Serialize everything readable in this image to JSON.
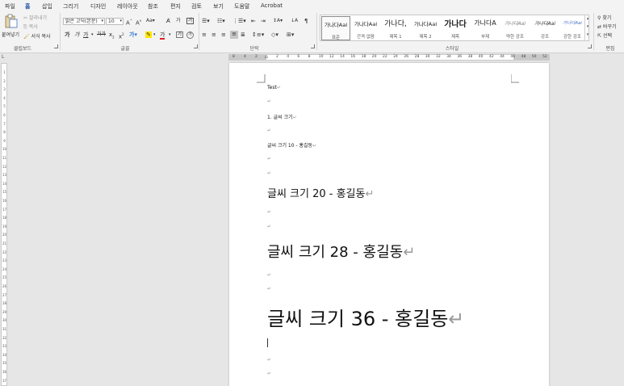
{
  "menu": {
    "items": [
      "파일",
      "홈",
      "삽입",
      "그리기",
      "디자인",
      "레이아웃",
      "참조",
      "편지",
      "검토",
      "보기",
      "도움말",
      "Acrobat"
    ],
    "active": "홈"
  },
  "clipboard": {
    "paste": "붙여넣기",
    "cut": "잘라내기",
    "copy": "복사",
    "format_painter": "서식 복사",
    "label": "클립보드"
  },
  "font": {
    "name": "맑은 고딕(본문)",
    "size": "10",
    "label": "글꼴"
  },
  "paragraph": {
    "label": "단락"
  },
  "styles": {
    "label": "스타일",
    "items": [
      {
        "sample": "가나다AaI",
        "name": "표준"
      },
      {
        "sample": "가나다AaI",
        "name": "간격 없음"
      },
      {
        "sample": "가나다,",
        "name": "제목 1"
      },
      {
        "sample": "가나다AaI",
        "name": "제목 2"
      },
      {
        "sample": "가나다",
        "name": "제목"
      },
      {
        "sample": "가나다A",
        "name": "부제"
      },
      {
        "sample": "가나다Aai",
        "name": "약한 강조"
      },
      {
        "sample": "가나다Aai",
        "name": "강조"
      },
      {
        "sample": "가나다Aai",
        "name": "강한 강조"
      }
    ]
  },
  "editing": {
    "find": "찾기",
    "replace": "바꾸기",
    "select": "선택",
    "label": "편집"
  },
  "ruler": {
    "left_numbers": [
      "8",
      "4",
      "2"
    ],
    "numbers": [
      "2",
      "4",
      "6",
      "8",
      "10",
      "12",
      "14",
      "16",
      "18",
      "20",
      "22",
      "24",
      "26",
      "28",
      "30",
      "32",
      "34",
      "36",
      "38",
      "40",
      "42",
      "44",
      "46",
      "48",
      "50",
      "52"
    ]
  },
  "vruler": {
    "numbers": [
      "1",
      "2",
      "3",
      "4",
      "5",
      "6",
      "7",
      "8",
      "9",
      "10",
      "11",
      "12",
      "13",
      "14",
      "15",
      "16",
      "17",
      "18",
      "19",
      "20",
      "21",
      "22",
      "23",
      "24",
      "25",
      "26",
      "27",
      "28",
      "29",
      "30",
      "31",
      "32",
      "33",
      "34",
      "35",
      "36",
      "37"
    ]
  },
  "document": {
    "paragraphs": [
      {
        "text": "Test",
        "mark": "↵"
      },
      {
        "text": "",
        "mark": "↵"
      },
      {
        "text": "1. 글씨 크기",
        "mark": "↵"
      },
      {
        "text": "",
        "mark": "↵"
      },
      {
        "text": "글씨 크기 10 - 홍길동",
        "mark": "↵"
      },
      {
        "text": "",
        "mark": "↵"
      },
      {
        "text": "",
        "mark": "↵"
      },
      {
        "text": "글씨 크기 20 - 홍길동",
        "mark": "↵"
      },
      {
        "text": "",
        "mark": "↵"
      },
      {
        "text": "",
        "mark": "↵"
      },
      {
        "text": "글씨 크기 28 - 홍길동",
        "mark": "↵"
      },
      {
        "text": "",
        "mark": "↵"
      },
      {
        "text": "",
        "mark": "↵"
      },
      {
        "text": "글씨 크기 36 - 홍길동",
        "mark": "↵"
      },
      {
        "text": "",
        "mark": ""
      },
      {
        "text": "",
        "mark": "↵"
      },
      {
        "text": "",
        "mark": "↵"
      }
    ]
  }
}
